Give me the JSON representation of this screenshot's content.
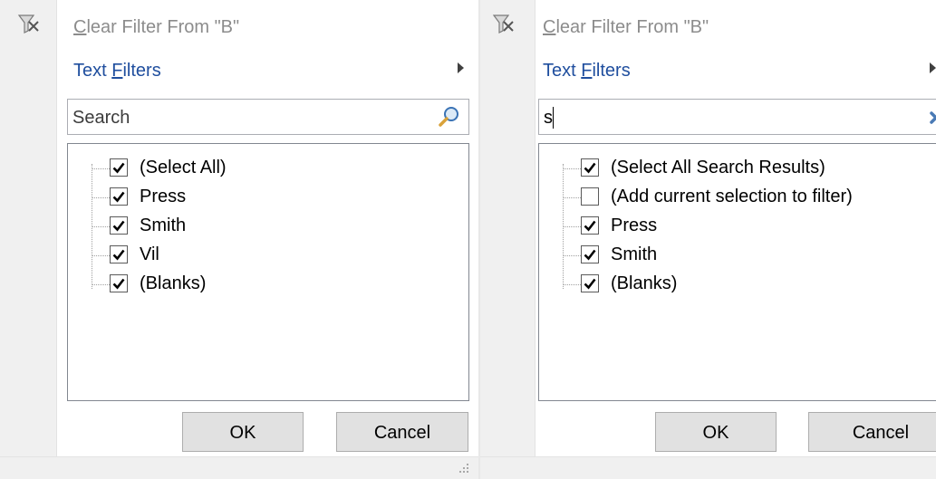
{
  "left_panel": {
    "clear_filter_label": "Clear Filter From \"B\"",
    "text_filters_label": "Text Filters",
    "search": {
      "value": "",
      "placeholder": "Search"
    },
    "items": [
      {
        "label": "(Select All)",
        "checked": true
      },
      {
        "label": "Press",
        "checked": true
      },
      {
        "label": "Smith",
        "checked": true
      },
      {
        "label": "Vil",
        "checked": true
      },
      {
        "label": "(Blanks)",
        "checked": true
      }
    ],
    "ok_label": "OK",
    "cancel_label": "Cancel"
  },
  "right_panel": {
    "clear_filter_label": "Clear Filter From \"B\"",
    "text_filters_label": "Text Filters",
    "search": {
      "value": "s",
      "placeholder": ""
    },
    "items": [
      {
        "label": "(Select All Search Results)",
        "checked": true
      },
      {
        "label": "(Add current selection to filter)",
        "checked": false
      },
      {
        "label": "Press",
        "checked": true
      },
      {
        "label": "Smith",
        "checked": true
      },
      {
        "label": "(Blanks)",
        "checked": true
      }
    ],
    "ok_label": "OK",
    "cancel_label": "Cancel"
  },
  "icons": {
    "clear_filter": "clear-filter-icon",
    "search": "magnifier-icon",
    "clear_search": "close-x-icon",
    "submenu": "chevron-right-icon",
    "resize": "resize-grip-icon"
  },
  "colors": {
    "link_blue": "#1f4e9e",
    "disabled_gray": "#8c8c8c",
    "gutter": "#f0f0f0",
    "clear_x": "#4a7ab5"
  }
}
